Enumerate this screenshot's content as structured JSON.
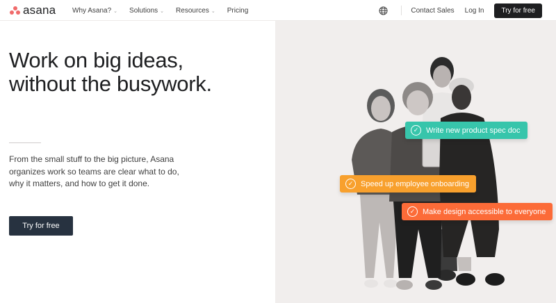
{
  "nav": {
    "logo_text": "asana",
    "links": [
      {
        "label": "Why Asana?",
        "has_dropdown": true
      },
      {
        "label": "Solutions",
        "has_dropdown": true
      },
      {
        "label": "Resources",
        "has_dropdown": true
      },
      {
        "label": "Pricing",
        "has_dropdown": false
      }
    ],
    "globe_icon": "globe-icon",
    "contact_sales": "Contact Sales",
    "log_in": "Log In",
    "try_free": "Try for free"
  },
  "hero": {
    "title_line1": "Work on big ideas,",
    "title_line2": "without the busywork.",
    "subtitle": "From the small stuff to the big picture, Asana organizes work so teams are clear what to do, why it matters, and how to get it done.",
    "cta": "Try for free"
  },
  "tasks": [
    {
      "label": "Write new product spec doc",
      "color": "#37c5ab"
    },
    {
      "label": "Speed up employee onboarding",
      "color": "#f8a02d"
    },
    {
      "label": "Make design accessible to everyone",
      "color": "#fc6b38"
    }
  ],
  "colors": {
    "brand": "#f06a6a",
    "dark_button": "#1e1f21",
    "hero_button": "#273240",
    "panel_bg": "#f1eeed"
  }
}
